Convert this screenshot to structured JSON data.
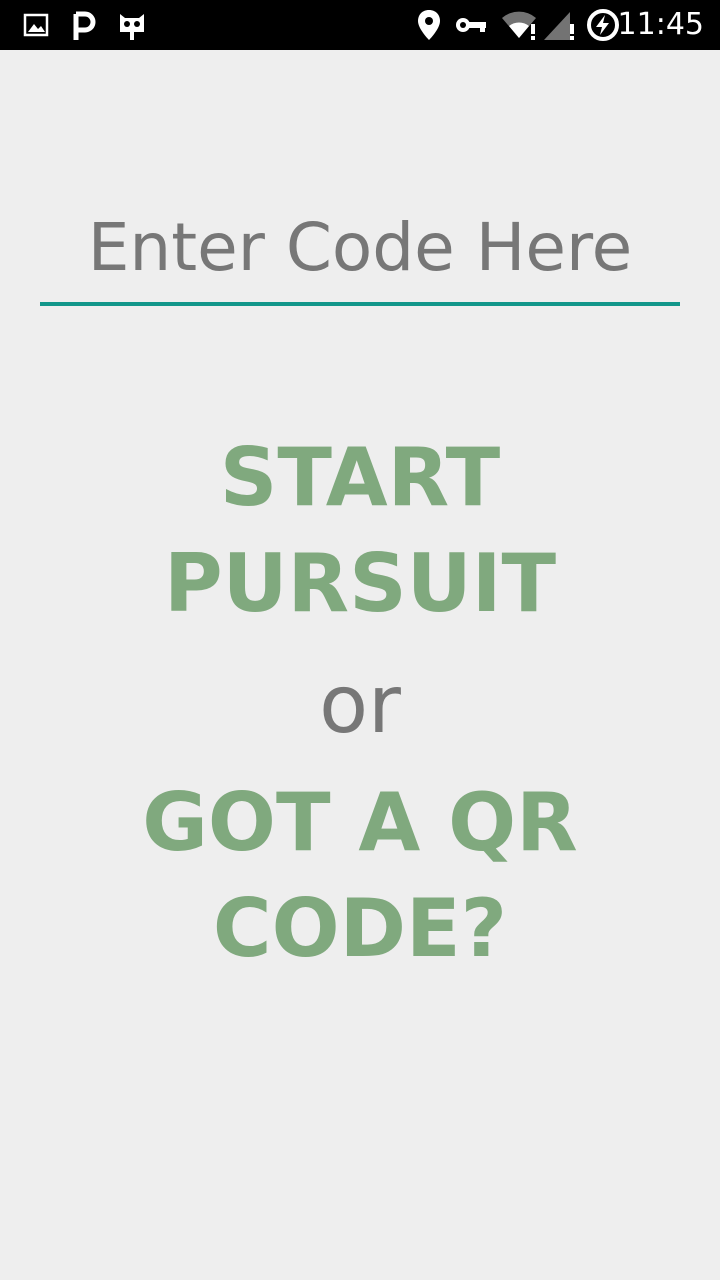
{
  "status_bar": {
    "time": "11:45",
    "icons": [
      "image-icon",
      "parking-icon",
      "cyanogen-bot-icon",
      "location-icon",
      "vpn-key-icon",
      "wifi-alert-icon",
      "cell-signal-alert-icon",
      "battery-charging-icon"
    ]
  },
  "main": {
    "code_input": {
      "placeholder": "Enter Code Here",
      "value": ""
    },
    "start_label_line1": "START",
    "start_label_line2": "PURSUIT",
    "or_text": "or",
    "qr_label_line1": "GOT A QR",
    "qr_label_line2": "CODE?"
  },
  "colors": {
    "accent_underline": "#12968a",
    "action_green": "#80a97e",
    "gray_text": "#777777",
    "background": "#eeeeee"
  }
}
